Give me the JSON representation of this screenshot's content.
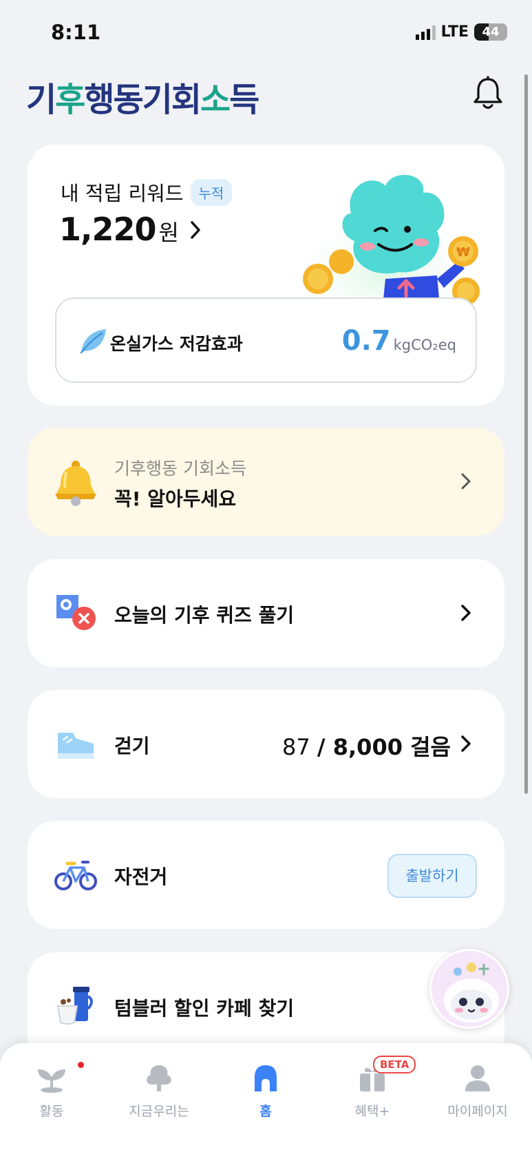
{
  "status_bar": {
    "time": "8:11",
    "network": "LTE",
    "battery": "44",
    "battery_level": 0.44
  },
  "header": {
    "logo_part1": "기",
    "logo_accent1": "후",
    "logo_part2": "행동기회",
    "logo_accent2": "소",
    "logo_part3": "득"
  },
  "reward": {
    "title": "내 적립 리워드",
    "badge": "누적",
    "amount": "1,220",
    "unit": "원",
    "ghg_label": "온실가스 저감효과",
    "ghg_value": "0.7",
    "ghg_unit": "kgCO₂eq"
  },
  "notice": {
    "subtitle": "기후행동 기회소득",
    "title": "꼭! 알아두세요"
  },
  "quiz": {
    "label": "오늘의 기후 퀴즈 풀기"
  },
  "walk": {
    "label": "걷기",
    "current": "87",
    "goal": "/ 8,000 걸음"
  },
  "bike": {
    "label": "자전거",
    "button": "출발하기"
  },
  "tumbler": {
    "label": "텀블러 할인 카페 찾기"
  },
  "tabs": [
    {
      "label": "활동"
    },
    {
      "label": "지금우리는"
    },
    {
      "label": "홈"
    },
    {
      "label": "혜택+",
      "badge": "BETA"
    },
    {
      "label": "마이페이지"
    }
  ],
  "colors": {
    "accent": "#3b82f6",
    "logo_navy": "#24357e",
    "logo_green": "#1ba48c",
    "notice_bg": "#fef8e6",
    "ghg_value": "#3d95dd"
  }
}
